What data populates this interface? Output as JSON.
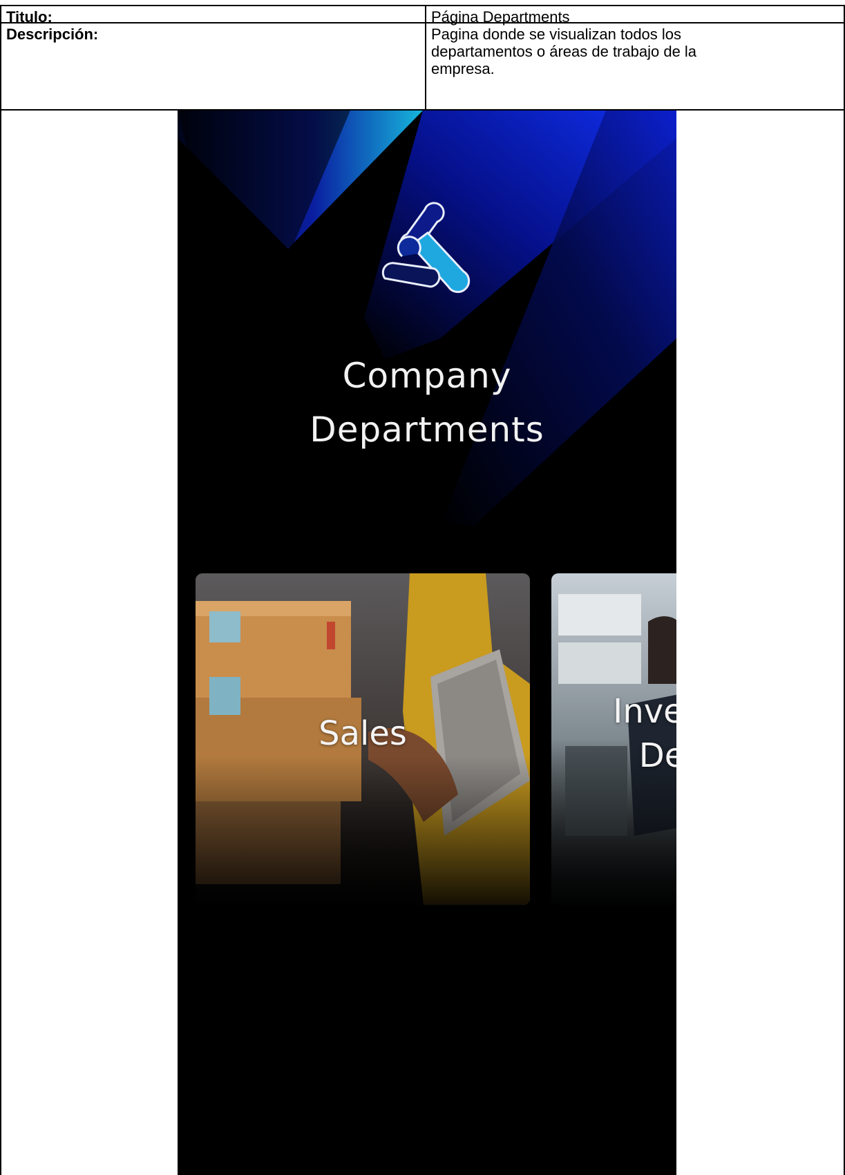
{
  "document": {
    "title_label": "Titulo:",
    "title_value": "Página Departments",
    "description_label": "Descripción:",
    "description_lines": [
      "Pagina donde se visualizan todos los",
      "departamentos o áreas de trabajo de la",
      "empresa."
    ]
  },
  "app": {
    "heading_line1": "Company",
    "heading_line2": "Departments",
    "departments": [
      {
        "label_lines": [
          "Sales"
        ]
      },
      {
        "label_lines": [
          "Investi",
          "Deve"
        ]
      }
    ],
    "colors": {
      "background": "#000000",
      "accent_blue": "#0a1fd6",
      "accent_cyan": "#18b4e6",
      "text": "#f2f2f2"
    }
  }
}
